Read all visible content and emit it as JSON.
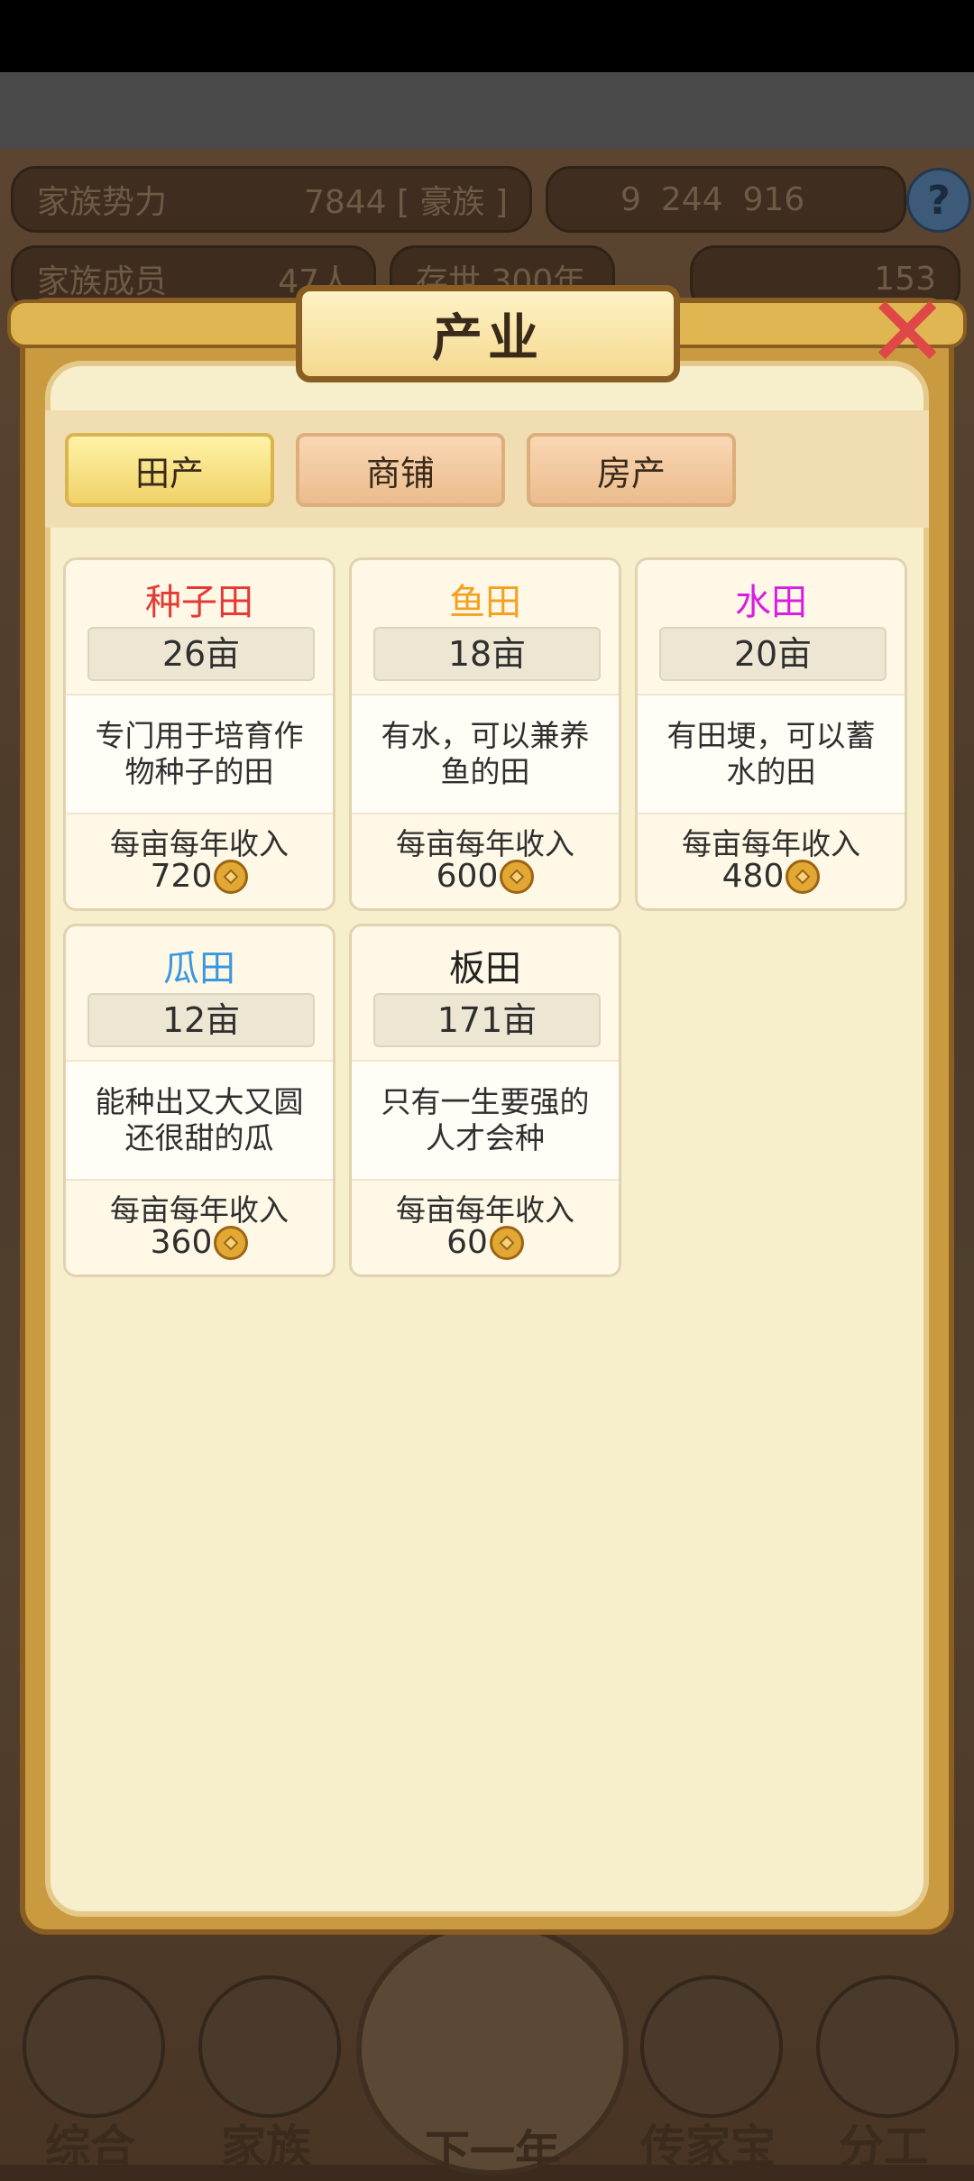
{
  "hud": {
    "power_label": "家族势力",
    "power_value": "7844 [ 豪族 ]",
    "currency": {
      "gold": "9",
      "silver": "244",
      "coins": "916"
    },
    "members_label": "家族成员",
    "members_value": "47人",
    "duration_label": "存世 300年",
    "ingots_value": "153",
    "help_label": "?"
  },
  "modal": {
    "title": "产业",
    "close_label": "✕",
    "tabs": [
      {
        "label": "田产",
        "active": true
      },
      {
        "label": "商铺",
        "active": false
      },
      {
        "label": "房产",
        "active": false
      }
    ],
    "fields": [
      {
        "name": "种子田",
        "color": "#e53935",
        "area": "26亩",
        "desc": "专门用于培育作物种子的田",
        "income_label": "每亩每年收入",
        "income": "720"
      },
      {
        "name": "鱼田",
        "color": "#f4a021",
        "area": "18亩",
        "desc": "有水，可以兼养鱼的田",
        "income_label": "每亩每年收入",
        "income": "600"
      },
      {
        "name": "水田",
        "color": "#d81fe0",
        "area": "20亩",
        "desc": "有田埂，可以蓄水的田",
        "income_label": "每亩每年收入",
        "income": "480"
      },
      {
        "name": "瓜田",
        "color": "#3a97e0",
        "area": "12亩",
        "desc": "能种出又大又圆还很甜的瓜",
        "income_label": "每亩每年收入",
        "income": "360"
      },
      {
        "name": "板田",
        "color": "#222222",
        "area": "171亩",
        "desc": "只有一生要强的人才会种",
        "income_label": "每亩每年收入",
        "income": "60"
      }
    ]
  },
  "bottom_nav": [
    "综合",
    "家族",
    "下一年",
    "传家宝",
    "分工"
  ]
}
